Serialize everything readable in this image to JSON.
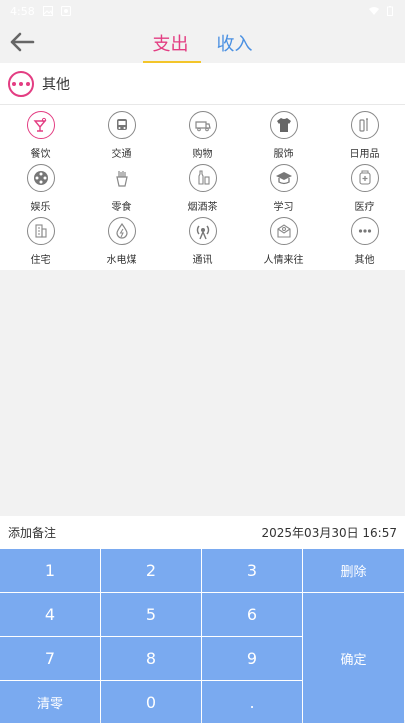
{
  "status_bar": {
    "time": "4:58"
  },
  "header": {
    "tabs": [
      {
        "label": "支出",
        "active": true
      },
      {
        "label": "收入",
        "active": false
      }
    ]
  },
  "selected_category": {
    "label": "其他"
  },
  "categories": [
    {
      "label": "餐饮",
      "icon": "dining-icon"
    },
    {
      "label": "交通",
      "icon": "bus-icon"
    },
    {
      "label": "购物",
      "icon": "shopping-cart-icon"
    },
    {
      "label": "服饰",
      "icon": "shirt-icon"
    },
    {
      "label": "日用品",
      "icon": "daily-goods-icon"
    },
    {
      "label": "娱乐",
      "icon": "film-reel-icon"
    },
    {
      "label": "零食",
      "icon": "fries-icon"
    },
    {
      "label": "烟酒茶",
      "icon": "bottle-icon"
    },
    {
      "label": "学习",
      "icon": "graduation-cap-icon"
    },
    {
      "label": "医疗",
      "icon": "medical-icon"
    },
    {
      "label": "住宅",
      "icon": "building-icon"
    },
    {
      "label": "水电煤",
      "icon": "water-drop-icon"
    },
    {
      "label": "通讯",
      "icon": "antenna-icon"
    },
    {
      "label": "人情来往",
      "icon": "letter-icon"
    },
    {
      "label": "其他",
      "icon": "more-dots-icon"
    }
  ],
  "note": {
    "placeholder": "添加备注",
    "datetime": "2025年03月30日 16:57"
  },
  "keypad": {
    "k1": "1",
    "k2": "2",
    "k3": "3",
    "delete": "删除",
    "k4": "4",
    "k5": "5",
    "k6": "6",
    "confirm": "确定",
    "k7": "7",
    "k8": "8",
    "k9": "9",
    "clear": "清零",
    "k0": "0",
    "dot": "."
  },
  "colors": {
    "accent": "#e33d82",
    "blue": "#4a90e2",
    "keypad": "#7aaaf0",
    "underline": "#f3c52a"
  }
}
